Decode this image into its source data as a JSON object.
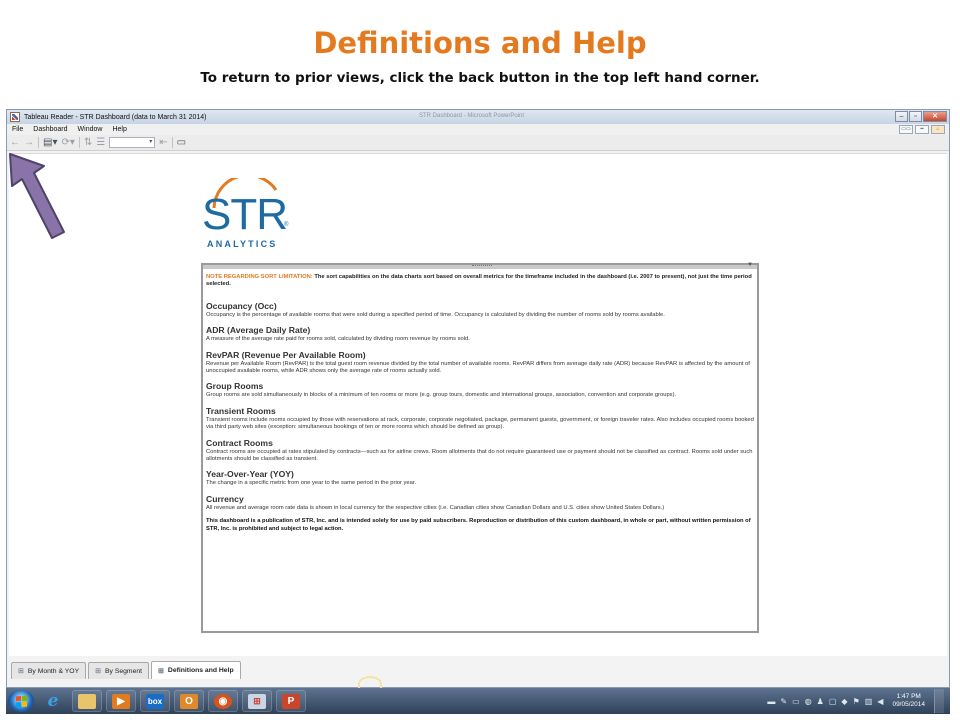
{
  "slide": {
    "title": "Definitions and Help",
    "subtitle": "To return to prior views, click the back button in the top left hand corner."
  },
  "window": {
    "title": "Tableau Reader - STR Dashboard (data to March 31 2014)",
    "ghost_title": "STR Dashboard - Microsoft PowerPoint",
    "menu": [
      "File",
      "Dashboard",
      "Window",
      "Help"
    ]
  },
  "logo": {
    "main": "STR",
    "sub": "ANALYTICS",
    "registered": "®"
  },
  "panel": {
    "note_label": "NOTE REGARDING SORT LIMITATION:",
    "note_text": " The sort capabilities on the data charts sort based on overall metrics for the timeframe included in the dashboard (i.e. 2007 to present), not just the time period selected.",
    "definitions": [
      {
        "title": "Occupancy (Occ)",
        "text": "Occupancy is the percentage of available rooms that were sold during a specified period of time. Occupancy is calculated by dividing the number of rooms sold by rooms available."
      },
      {
        "title": "ADR (Average Daily Rate)",
        "text": "A measure of the average rate paid for rooms sold, calculated by dividing room revenue by rooms sold."
      },
      {
        "title": "RevPAR (Revenue Per Available Room)",
        "text": "Revenue per Available Room (RevPAR) is the total guest room revenue divided by the total number of available rooms. RevPAR differs from average daily rate (ADR) because RevPAR is affected by the amount of unoccupied available rooms, while ADR shows only the average rate of rooms actually sold."
      },
      {
        "title": "Group Rooms",
        "text": "Group rooms are sold simultaneously in blocks of a minimum of ten rooms or more (e.g. group tours, domestic and international groups, association, convention and corporate groups)."
      },
      {
        "title": "Transient Rooms",
        "text": "Transient rooms include rooms occupied by those with reservations at rack, corporate, corporate negotiated, package, permanent guests, government, or foreign traveler rates. Also includes occupied rooms booked via third party web sites (exception: simultaneous bookings of ten or more rooms which should be defined as group)."
      },
      {
        "title": "Contract Rooms",
        "text": "Contract rooms are occupied at rates stipulated by contracts—such as for airline crews. Room allotments that do not require guaranteed use or payment should not be classified as contract. Rooms sold under such allotments should be classified as transient."
      },
      {
        "title": "Year-Over-Year (YOY)",
        "text": "The change in a specific metric from one year to the same period in the prior year."
      },
      {
        "title": "Currency",
        "text": "All revenue and average room rate data is shown in local currency for the respective cities (i.e. Canadian cities show Canadian Dollars and U.S. cities show United States Dollars.)"
      }
    ],
    "disclaimer": "This dashboard is a publication of STR, Inc. and is intended solely for use by paid subscribers.  Reproduction or distribution of this custom dashboard, in whole or part, without written permission of STR, Inc. is prohibited and subject to legal action."
  },
  "tabs": [
    {
      "label": "By Month & YOY",
      "active": false
    },
    {
      "label": "By Segment",
      "active": false
    },
    {
      "label": "Definitions and Help",
      "active": true
    }
  ],
  "taskbar": {
    "apps": [
      "internet-explorer",
      "file-explorer",
      "media-player",
      "box",
      "outlook",
      "firefox",
      "calculator",
      "powerpoint"
    ],
    "box_label": "box",
    "time": "1:47 PM",
    "date": "09/05/2014"
  },
  "colors": {
    "accent": "#e37a1f",
    "logo_blue": "#1e6aa3",
    "arrow_fill": "#8a73a8"
  }
}
